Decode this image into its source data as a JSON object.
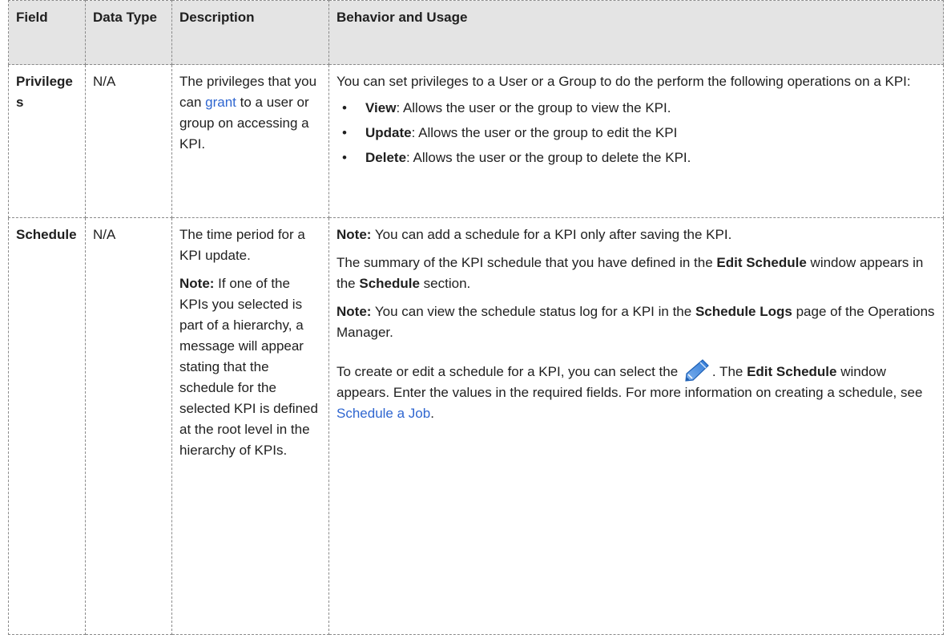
{
  "columns": {
    "field": "Field",
    "data_type": "Data Type",
    "description": "Description",
    "behavior": "Behavior and Usage"
  },
  "privileges": {
    "field": "Privileges",
    "data_type": "N/A",
    "desc_before": "The privileges that you can ",
    "desc_link": "grant",
    "desc_after": " to a user or group on accessing a KPI.",
    "intro": "You can set privileges to a User or a Group to do the perform the following operations on a KPI:",
    "operations": [
      {
        "name": "View",
        "text": ": Allows the user or the group to view the KPI."
      },
      {
        "name": "Update",
        "text": ": Allows the user or the group to edit the KPI"
      },
      {
        "name": "Delete",
        "text": ": Allows the user or the group to delete the KPI."
      }
    ]
  },
  "schedule": {
    "field": "Schedule",
    "data_type": "N/A",
    "desc_main": "The time period for a KPI update.",
    "desc_note_label": "Note:",
    "desc_note_text": " If one of the KPIs you selected is part of a hierarchy, a message will appear stating that the schedule for the selected KPI is defined at the root level in the hierarchy of KPIs.",
    "note1_label": "Note:",
    "note1_text": " You can add a schedule for a KPI only after saving the KPI.",
    "summary_1": "The summary of the KPI schedule that you have defined in the ",
    "summary_bold_1": "Edit Schedule",
    "summary_2": " window appears in the ",
    "summary_bold_2": "Schedule",
    "summary_3": " section.",
    "note2_label": "Note:",
    "note2_text": " You can view the schedule status log for a KPI in the ",
    "note2_bold": "Schedule Logs",
    "note2_after": " page of the Operations Manager.",
    "create_1": "To create or edit a schedule for a KPI, you can select the ",
    "create_2": ". The ",
    "create_bold": "Edit Schedule",
    "create_3": " window appears. Enter the values in the required fields. For more information on creating a schedule, see ",
    "create_link": "Schedule a Job",
    "create_4": ".",
    "icon": "pencil-icon"
  },
  "colors": {
    "header_bg": "#e4e4e4",
    "link": "#2f66d0",
    "border": "#8a8a8a"
  }
}
